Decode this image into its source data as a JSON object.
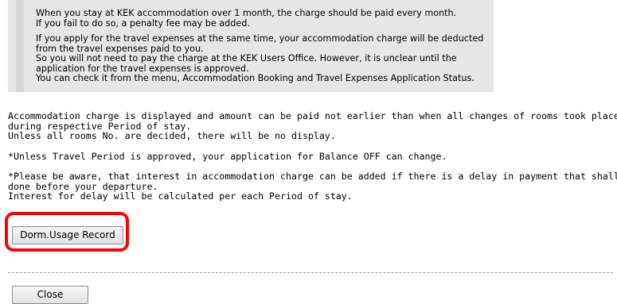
{
  "notice": {
    "paragraphs": [
      {
        "lines": [
          "When you stay at KEK accommodation over 1 month, the charge should be paid every month.",
          "If you fail to do so, a penalty fee may be added."
        ]
      },
      {
        "lines": [
          "If you apply for the travel expenses at the same time, your accommodation charge will be deducted",
          "from the travel expenses paid to you.",
          "So you will not need to pay the charge at the KEK Users Office. However, it is unclear until the",
          "application for the travel expenses is approved.",
          "You can check it from the menu, Accommodation Booking and Travel Expenses Application Status."
        ]
      }
    ]
  },
  "info": {
    "paragraphs": [
      {
        "lines": [
          "Accommodation charge is displayed and amount can be paid not earlier than when all changes of rooms took place",
          "during respective Period of stay.",
          "Unless all rooms No. are decided, there will be no display."
        ]
      },
      {
        "lines": [
          "*Unless Travel Period is approved, your application for Balance OFF can change."
        ]
      },
      {
        "lines": [
          "*Please be aware, that interest in accommodation charge can be added if there is a delay in payment that shall be",
          "done before your departure.",
          "Interest for delay will be calculated per each Period of stay."
        ]
      }
    ]
  },
  "buttons": {
    "dorm_usage_record": "Dorm.Usage Record",
    "close": "Close"
  },
  "colors": {
    "highlight": "#ff0000",
    "notice_background": "#e6e6e6"
  }
}
